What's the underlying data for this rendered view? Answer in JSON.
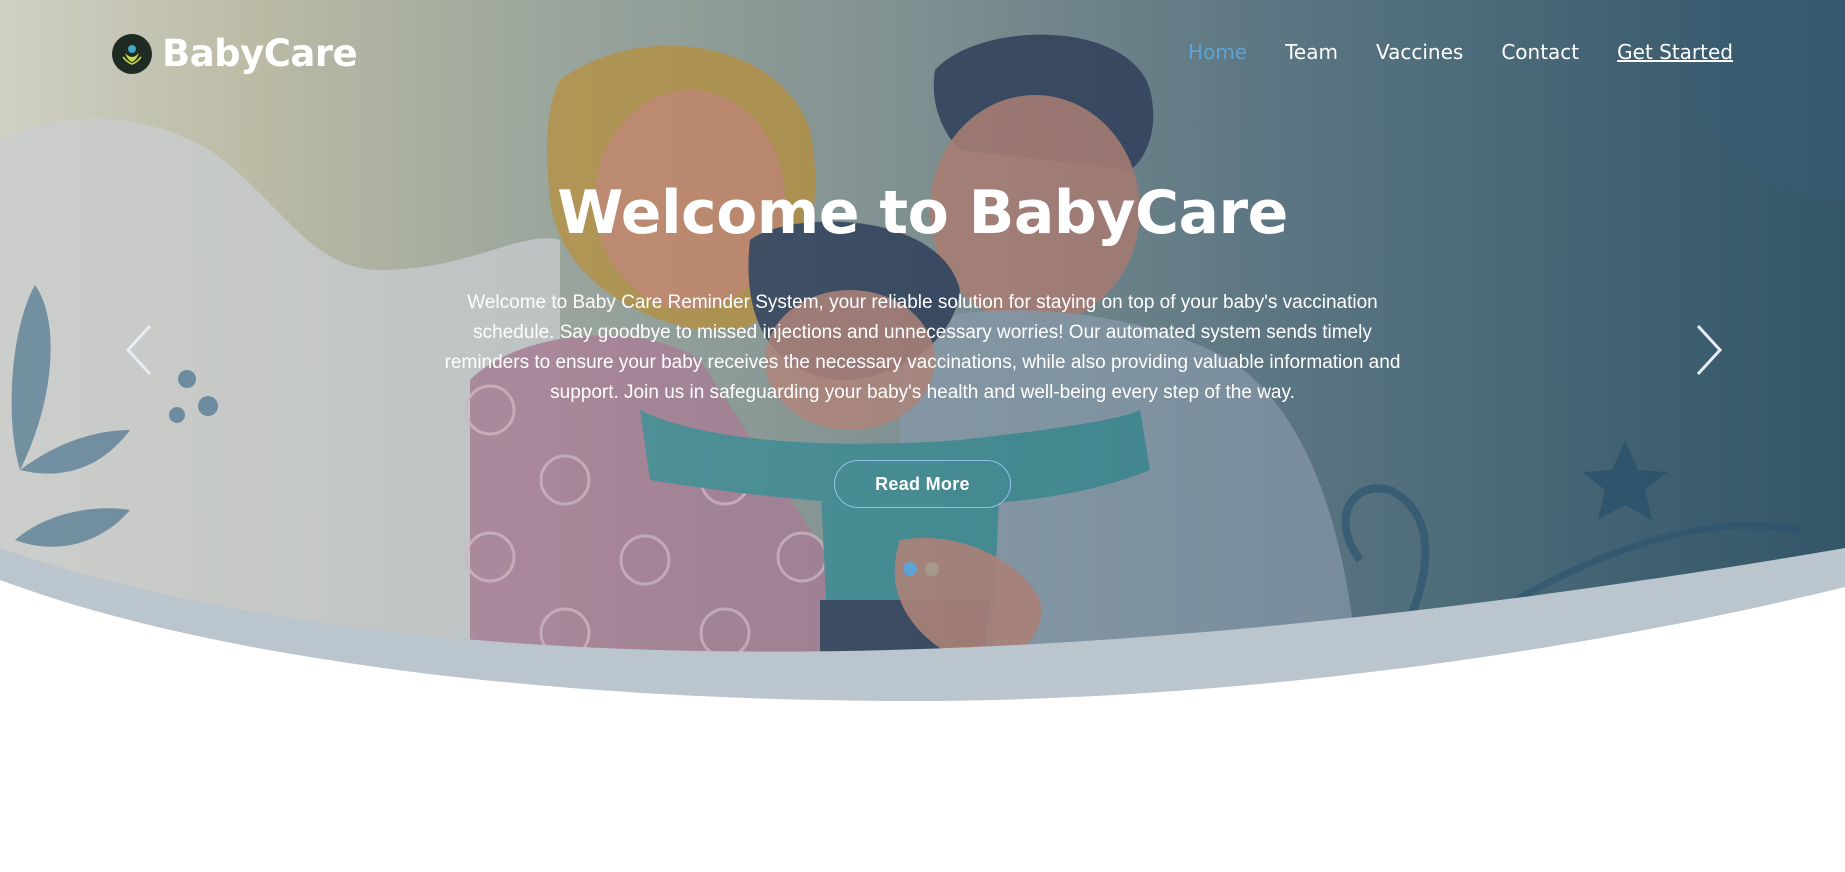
{
  "brand": {
    "name": "BabyCare",
    "logo_icon": "baby-care-logo-icon"
  },
  "nav": {
    "items": [
      {
        "label": "Home",
        "active": true
      },
      {
        "label": "Team",
        "active": false
      },
      {
        "label": "Vaccines",
        "active": false
      },
      {
        "label": "Contact",
        "active": false
      }
    ],
    "cta_label": "Get Started"
  },
  "hero": {
    "title": "Welcome to BabyCare",
    "text": "Welcome to Baby Care Reminder System, your reliable solution for staying on top of your baby's vaccination schedule. Say goodbye to missed injections and unnecessary worries! Our automated system sends timely reminders to ensure your baby receives the necessary vaccinations, while also providing valuable information and support. Join us in safeguarding your baby's health and well-being every step of the way.",
    "button_label": "Read More",
    "slides": 2,
    "active_slide": 1,
    "prev_icon": "chevron-left-icon",
    "next_icon": "chevron-right-icon"
  },
  "colors": {
    "accent": "#5ea3d6",
    "text": "#ffffff"
  }
}
